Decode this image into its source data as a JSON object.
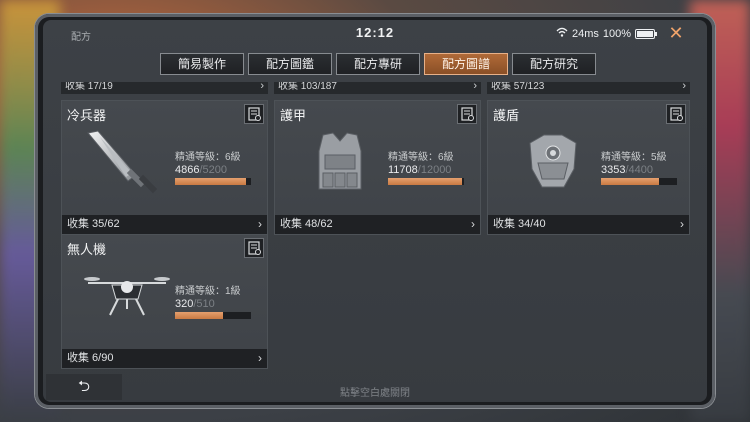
{
  "status": {
    "app_title": "配方",
    "time": "12:12",
    "network": "24ms",
    "battery": "100%"
  },
  "tabs": [
    {
      "label": "簡易製作"
    },
    {
      "label": "配方圖鑑"
    },
    {
      "label": "配方專研"
    },
    {
      "label": "配方圖譜"
    },
    {
      "label": "配方研究"
    }
  ],
  "active_tab": "配方圖譜",
  "top_strips": [
    {
      "label": "收集 17/19"
    },
    {
      "label": "收集 103/187"
    },
    {
      "label": "收集 57/123"
    }
  ],
  "cards": [
    {
      "name": "冷兵器",
      "mastery": "精通等級：6級",
      "progress": "4866",
      "progress_max": "/5200",
      "fill_percent": 93,
      "collection": "收集 35/62",
      "art": "blade-icon"
    },
    {
      "name": "護甲",
      "mastery": "精通等級：6級",
      "progress": "11708",
      "progress_max": "/12000",
      "fill_percent": 97,
      "collection": "收集 48/62",
      "art": "vest-icon"
    },
    {
      "name": "護盾",
      "mastery": "精通等級：5級",
      "progress": "3353",
      "progress_max": "/4400",
      "fill_percent": 76,
      "collection": "收集 34/40",
      "art": "shield-armor-icon"
    },
    {
      "name": "無人機",
      "mastery": "精通等級：1級",
      "progress": "320",
      "progress_max": "/510",
      "fill_percent": 63,
      "collection": "收集 6/90",
      "art": "drone-icon"
    }
  ],
  "hint": "點擊空白處關閉",
  "back_label": "⮌"
}
